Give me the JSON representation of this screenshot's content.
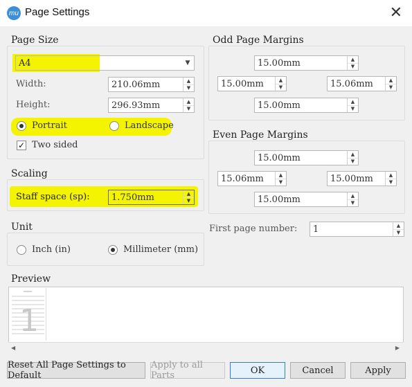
{
  "window": {
    "icon_text": "mu",
    "title": "Page Settings",
    "close_glyph": "✕"
  },
  "highlight_color": "#f4f400",
  "page_size": {
    "title": "Page Size",
    "paper": "A4",
    "width_label": "Width:",
    "width_value": "210.06mm",
    "height_label": "Height:",
    "height_value": "296.93mm",
    "orientation": [
      {
        "label": "Portrait",
        "selected": true
      },
      {
        "label": "Landscape",
        "selected": false
      }
    ],
    "two_sided_label": "Two sided",
    "two_sided_checked": true
  },
  "scaling": {
    "title": "Scaling",
    "staff_space_label": "Staff space (sp):",
    "staff_space_value": "1.750mm"
  },
  "unit": {
    "title": "Unit",
    "options": [
      {
        "label": "Inch (in)",
        "selected": false
      },
      {
        "label": "Millimeter (mm)",
        "selected": true
      }
    ]
  },
  "odd_margins": {
    "title": "Odd Page Margins",
    "top": "15.00mm",
    "left": "15.00mm",
    "right": "15.06mm",
    "bottom": "15.00mm"
  },
  "even_margins": {
    "title": "Even Page Margins",
    "top": "15.00mm",
    "left": "15.06mm",
    "right": "15.00mm",
    "bottom": "15.00mm"
  },
  "first_page": {
    "label": "First page number:",
    "value": "1"
  },
  "preview": {
    "title": "Preview",
    "page_number": "1"
  },
  "buttons": {
    "reset": "Reset All Page Settings to Default",
    "apply_all": "Apply to all Parts",
    "ok": "OK",
    "cancel": "Cancel",
    "apply": "Apply"
  }
}
